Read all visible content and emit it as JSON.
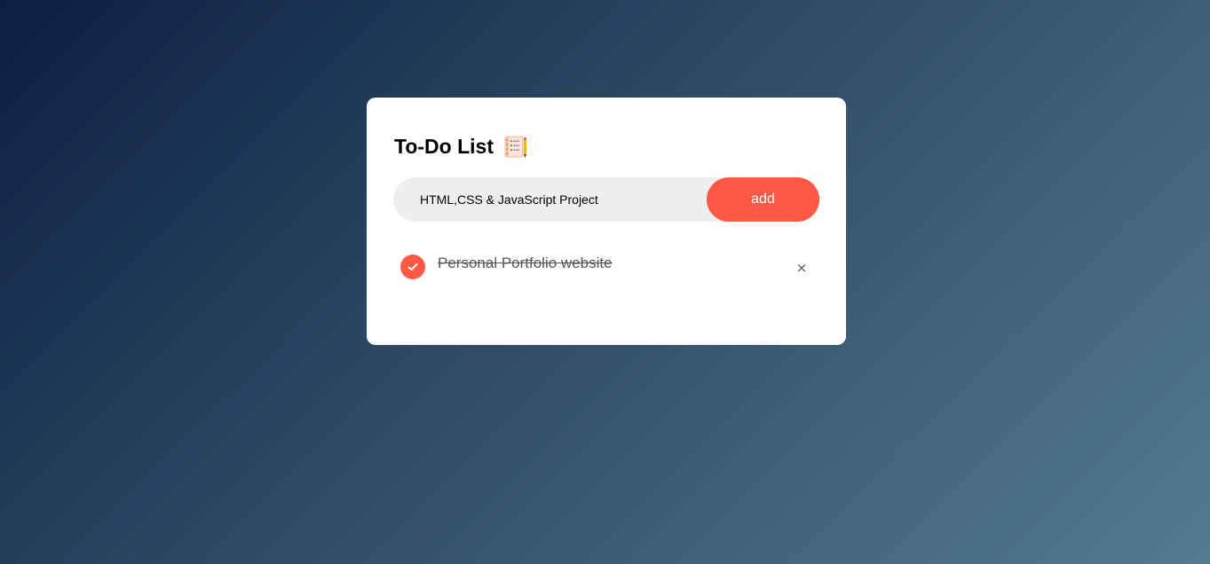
{
  "app": {
    "title": "To-Do List",
    "title_icon": "notepad-with-pencil-icon"
  },
  "input": {
    "value": "HTML,CSS & JavaScript Project",
    "placeholder": ""
  },
  "add_button": {
    "label": "add"
  },
  "tasks": [
    {
      "text": "Personal Portfolio website",
      "checked": true,
      "delete_label": "×"
    }
  ],
  "colors": {
    "accent": "#ff5945",
    "card_background": "#ffffff",
    "input_background": "#edeef0",
    "gradient_start": "#0b1f40",
    "gradient_end": "#557a93"
  }
}
